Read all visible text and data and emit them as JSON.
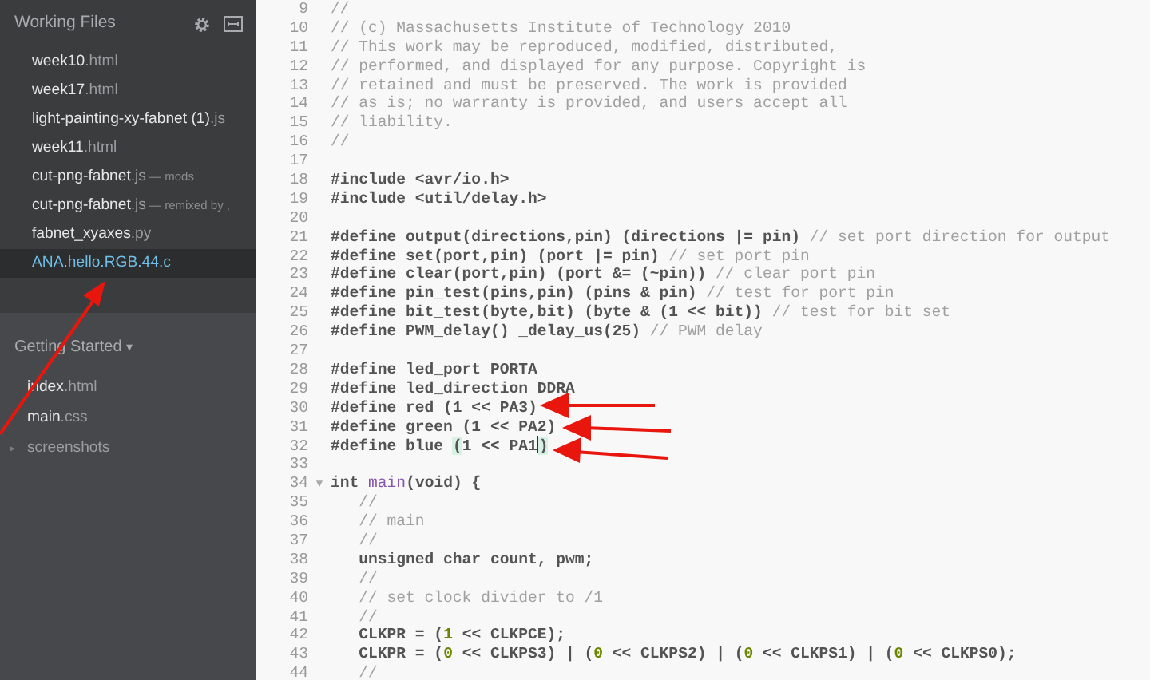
{
  "sidebar": {
    "working_files": {
      "title": "Working Files",
      "files": [
        {
          "name": "week10",
          "ext": ".html",
          "selected": false
        },
        {
          "name": "week17",
          "ext": ".html",
          "selected": false
        },
        {
          "name": "light-painting-xy-fabnet (1)",
          "ext": ".js",
          "selected": false
        },
        {
          "name": "week11",
          "ext": ".html",
          "selected": false
        },
        {
          "name": "cut-png-fabnet",
          "ext": ".js",
          "note": " — mods",
          "selected": false
        },
        {
          "name": "cut-png-fabnet",
          "ext": ".js",
          "note": " — remixed by ,",
          "selected": false
        },
        {
          "name": "fabnet_xyaxes",
          "ext": ".py",
          "selected": false
        },
        {
          "name": "ANA.hello.RGB.44.c",
          "selected": true
        }
      ]
    },
    "project": {
      "title": "Getting Started",
      "caret": "▾",
      "items": [
        {
          "kind": "file",
          "name": "index",
          "ext": ".html"
        },
        {
          "kind": "file",
          "name": "main",
          "ext": ".css"
        },
        {
          "kind": "folder",
          "name": "screenshots",
          "toggle": "▸",
          "expanded": false
        }
      ]
    }
  },
  "editor": {
    "lines": [
      {
        "number": "9",
        "segments": [
          {
            "kind": "comment",
            "text": "//"
          }
        ]
      },
      {
        "number": "10",
        "segments": [
          {
            "kind": "comment",
            "text": "// (c) Massachusetts Institute of Technology 2010"
          }
        ]
      },
      {
        "number": "11",
        "segments": [
          {
            "kind": "comment",
            "text": "// This work may be reproduced, modified, distributed,"
          }
        ]
      },
      {
        "number": "12",
        "segments": [
          {
            "kind": "comment",
            "text": "// performed, and displayed for any purpose. Copyright is"
          }
        ]
      },
      {
        "number": "13",
        "segments": [
          {
            "kind": "comment",
            "text": "// retained and must be preserved. The work is provided"
          }
        ]
      },
      {
        "number": "14",
        "segments": [
          {
            "kind": "comment",
            "text": "// as is; no warranty is provided, and users accept all"
          }
        ]
      },
      {
        "number": "15",
        "segments": [
          {
            "kind": "comment",
            "text": "// liability."
          }
        ]
      },
      {
        "number": "16",
        "segments": [
          {
            "kind": "comment",
            "text": "//"
          }
        ]
      },
      {
        "number": "17"
      },
      {
        "number": "18",
        "segments": [
          {
            "kind": "plain",
            "text": "#include <avr/io.h>"
          }
        ]
      },
      {
        "number": "19",
        "segments": [
          {
            "kind": "plain",
            "text": "#include <util/delay.h>"
          }
        ]
      },
      {
        "number": "20"
      },
      {
        "number": "21",
        "segments": [
          {
            "kind": "plain",
            "text": "#define output(directions,pin) (directions |= pin) "
          },
          {
            "kind": "comment",
            "text": "// set port direction for output"
          }
        ]
      },
      {
        "number": "22",
        "segments": [
          {
            "kind": "plain",
            "text": "#define set(port,pin) (port |= pin) "
          },
          {
            "kind": "comment",
            "text": "// set port pin"
          }
        ]
      },
      {
        "number": "23",
        "segments": [
          {
            "kind": "plain",
            "text": "#define clear(port,pin) (port &= (~pin)) "
          },
          {
            "kind": "comment",
            "text": "// clear port pin"
          }
        ]
      },
      {
        "number": "24",
        "segments": [
          {
            "kind": "plain",
            "text": "#define pin_test(pins,pin) (pins & pin) "
          },
          {
            "kind": "comment",
            "text": "// test for port pin"
          }
        ]
      },
      {
        "number": "25",
        "segments": [
          {
            "kind": "plain",
            "text": "#define bit_test(byte,bit) (byte & (1 << bit)) "
          },
          {
            "kind": "comment",
            "text": "// test for bit set"
          }
        ]
      },
      {
        "number": "26",
        "segments": [
          {
            "kind": "plain",
            "text": "#define PWM_delay() _delay_us(25) "
          },
          {
            "kind": "comment",
            "text": "// PWM delay"
          }
        ]
      },
      {
        "number": "27"
      },
      {
        "number": "28",
        "segments": [
          {
            "kind": "plain",
            "text": "#define led_port PORTA"
          }
        ]
      },
      {
        "number": "29",
        "segments": [
          {
            "kind": "plain",
            "text": "#define led_direction DDRA"
          }
        ]
      },
      {
        "number": "30",
        "segments": [
          {
            "kind": "plain",
            "text": "#define red (1 << PA3)"
          }
        ]
      },
      {
        "number": "31",
        "segments": [
          {
            "kind": "plain",
            "text": "#define green (1 << PA2)"
          }
        ]
      },
      {
        "number": "32",
        "segments": [
          {
            "kind": "plain",
            "text": "#define blue "
          },
          {
            "kind": "match",
            "text": "("
          },
          {
            "kind": "plain",
            "text": "1 << PA1"
          },
          {
            "kind": "cursor"
          },
          {
            "kind": "match",
            "text": ")"
          }
        ]
      },
      {
        "number": "33"
      },
      {
        "number": "34",
        "fold": "▼",
        "segments": [
          {
            "kind": "plain",
            "text": "int "
          },
          {
            "kind": "def",
            "text": "main"
          },
          {
            "kind": "plain",
            "text": "(void) {"
          }
        ]
      },
      {
        "number": "35",
        "segments": [
          {
            "kind": "comment",
            "text": "   //"
          }
        ]
      },
      {
        "number": "36",
        "segments": [
          {
            "kind": "comment",
            "text": "   // main"
          }
        ]
      },
      {
        "number": "37",
        "segments": [
          {
            "kind": "comment",
            "text": "   //"
          }
        ]
      },
      {
        "number": "38",
        "segments": [
          {
            "kind": "plain",
            "text": "   unsigned char count, pwm;"
          }
        ]
      },
      {
        "number": "39",
        "segments": [
          {
            "kind": "comment",
            "text": "   //"
          }
        ]
      },
      {
        "number": "40",
        "segments": [
          {
            "kind": "comment",
            "text": "   // set clock divider to /1"
          }
        ]
      },
      {
        "number": "41",
        "segments": [
          {
            "kind": "comment",
            "text": "   //"
          }
        ]
      },
      {
        "number": "42",
        "segments": [
          {
            "kind": "plain",
            "text": "   CLKPR = ("
          },
          {
            "kind": "number",
            "text": "1"
          },
          {
            "kind": "plain",
            "text": " << CLKPCE);"
          }
        ]
      },
      {
        "number": "43",
        "segments": [
          {
            "kind": "plain",
            "text": "   CLKPR = ("
          },
          {
            "kind": "number",
            "text": "0"
          },
          {
            "kind": "plain",
            "text": " << CLKPS3) | ("
          },
          {
            "kind": "number",
            "text": "0"
          },
          {
            "kind": "plain",
            "text": " << CLKPS2) | ("
          },
          {
            "kind": "number",
            "text": "0"
          },
          {
            "kind": "plain",
            "text": " << CLKPS1) | ("
          },
          {
            "kind": "number",
            "text": "0"
          },
          {
            "kind": "plain",
            "text": " << CLKPS0);"
          }
        ]
      },
      {
        "number": "44",
        "segments": [
          {
            "kind": "comment",
            "text": "   //"
          }
        ]
      }
    ]
  }
}
